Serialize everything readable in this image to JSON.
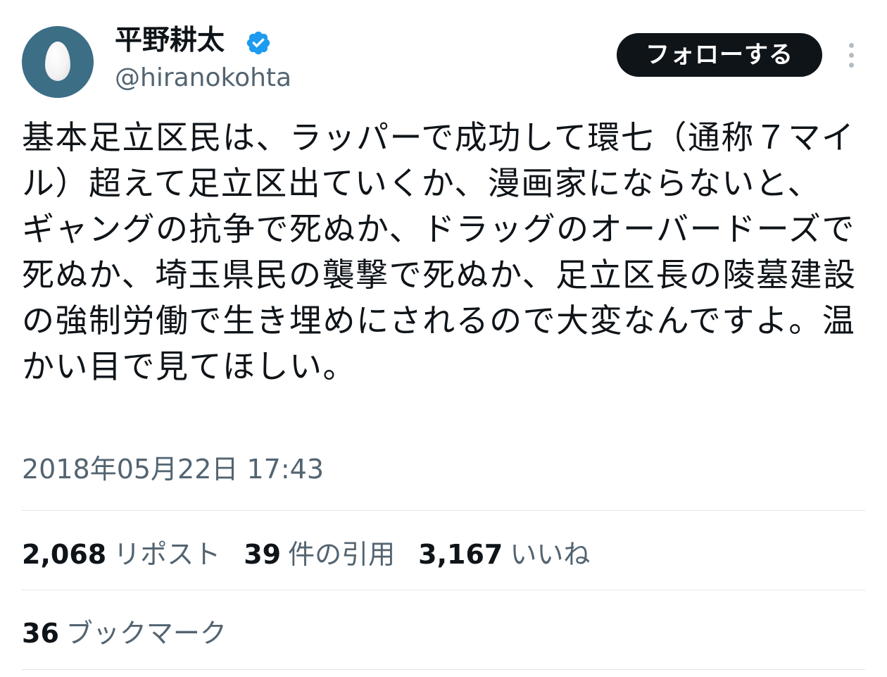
{
  "user": {
    "display_name": "平野耕太",
    "handle": "@hiranokohta",
    "verified_icon": "verified-badge-icon",
    "avatar_icon": "egg-avatar",
    "avatar_bg": "#3c6e86"
  },
  "actions": {
    "follow_label": "フォローする",
    "more_icon": "more-vertical-icon"
  },
  "tweet": {
    "text": "基本足立区民は、ラッパーで成功して環七（通称７マイル）超えて足立区出ていくか、漫画家にならないと、\nギャングの抗争で死ぬか、ドラッグのオーバードーズで死ぬか、埼玉県民の襲撃で死ぬか、足立区長の陵墓建設の強制労働で生き埋めにされるので大変なんですよ。温かい目で見てほしい。",
    "timestamp": "2018年05月22日 17:43"
  },
  "stats": {
    "reposts": {
      "count": "2,068",
      "label": "リポスト"
    },
    "quotes": {
      "count": "39",
      "label": "件の引用"
    },
    "likes": {
      "count": "3,167",
      "label": "いいね"
    },
    "bookmarks": {
      "count": "36",
      "label": "ブックマーク"
    }
  },
  "colors": {
    "text_primary": "#0f1419",
    "text_secondary": "#536471",
    "verified_blue": "#1d9bf0",
    "button_bg": "#0f1419",
    "divider": "#e1e5e8"
  }
}
